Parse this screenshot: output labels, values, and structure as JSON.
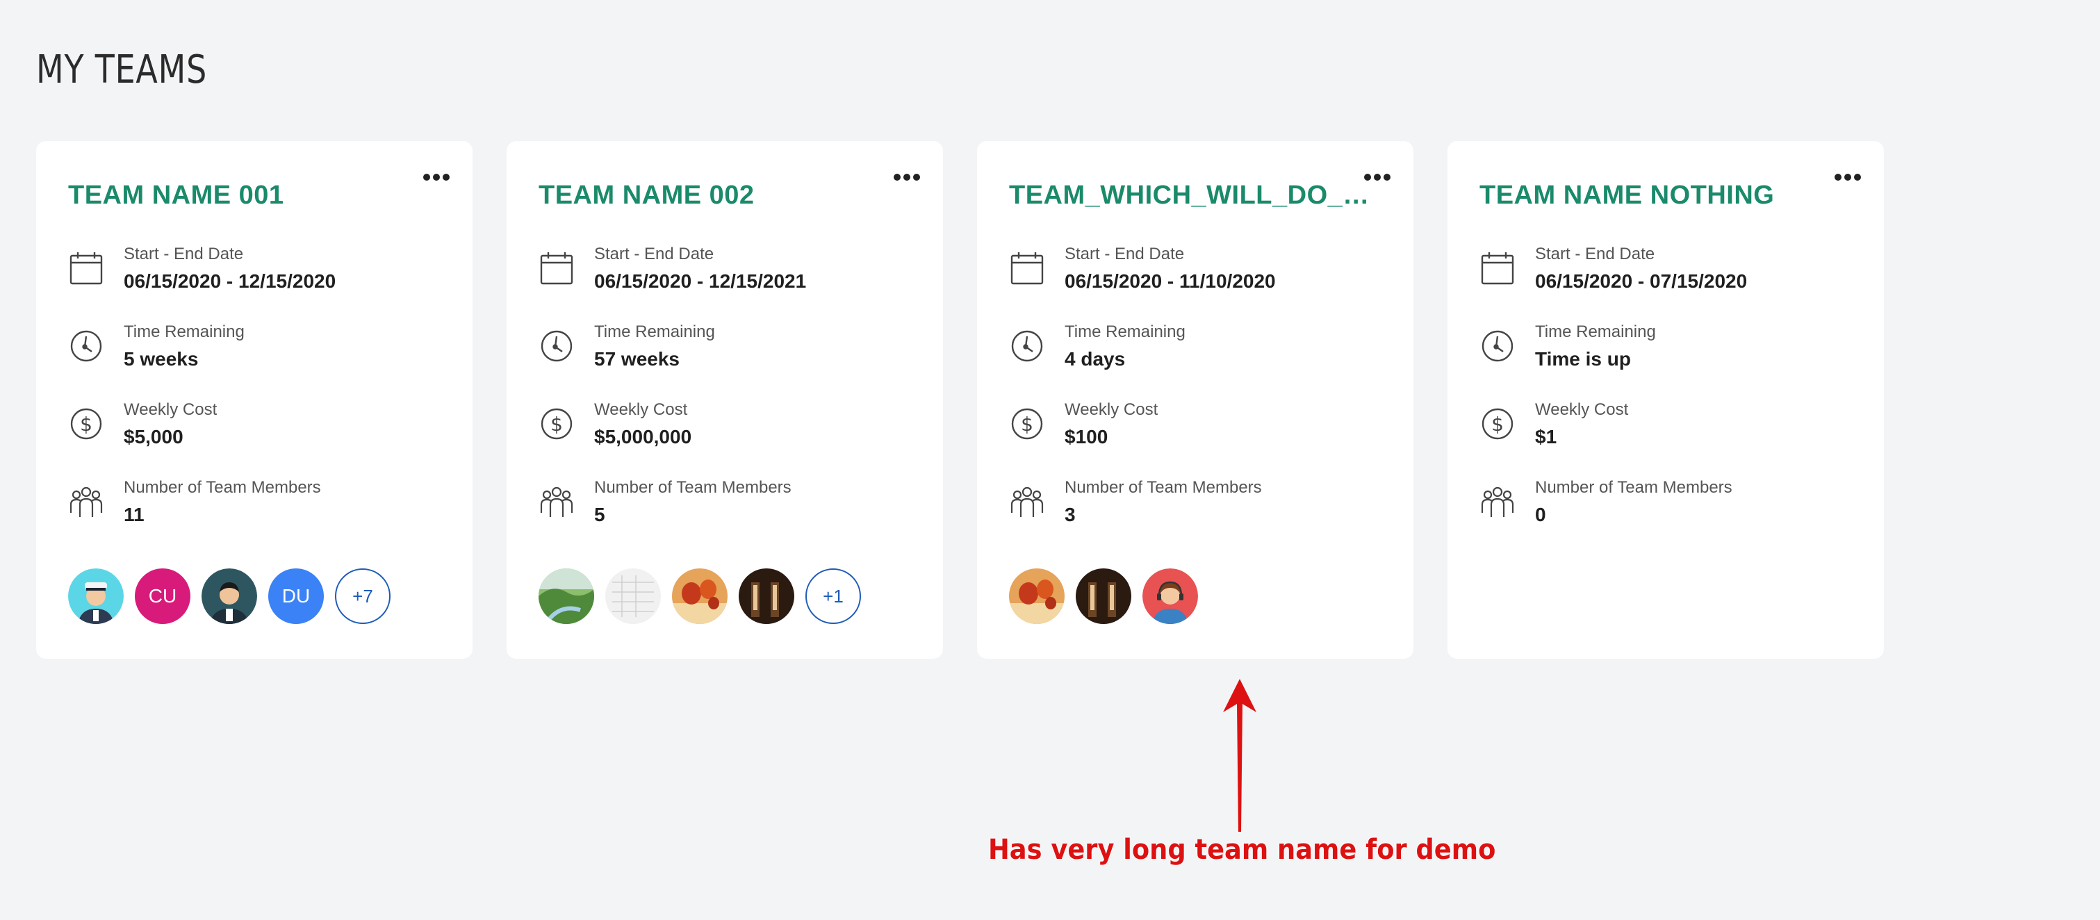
{
  "page": {
    "title": "MY TEAMS"
  },
  "labels": {
    "dates": "Start - End Date",
    "time": "Time Remaining",
    "cost": "Weekly Cost",
    "members": "Number of Team Members"
  },
  "teams": [
    {
      "name": "TEAM NAME 001",
      "dates": "06/15/2020 - 12/15/2020",
      "time_remaining": "5 weeks",
      "weekly_cost": "$5,000",
      "member_count": "11",
      "avatars": [
        {
          "type": "image",
          "icon": "captain-avatar"
        },
        {
          "type": "initials",
          "text": "CU",
          "color": "#d81b7a"
        },
        {
          "type": "image",
          "icon": "man-avatar"
        },
        {
          "type": "initials",
          "text": "DU",
          "color": "#3b82f6"
        },
        {
          "type": "more",
          "text": "+7"
        }
      ]
    },
    {
      "name": "TEAM NAME 002",
      "dates": "06/15/2020 - 12/15/2021",
      "time_remaining": "57 weeks",
      "weekly_cost": "$5,000,000",
      "member_count": "5",
      "avatars": [
        {
          "type": "image",
          "icon": "landscape-photo"
        },
        {
          "type": "image",
          "icon": "sketch-photo"
        },
        {
          "type": "image",
          "icon": "balloons-photo"
        },
        {
          "type": "image",
          "icon": "dark-room-photo"
        },
        {
          "type": "more",
          "text": "+1"
        }
      ]
    },
    {
      "name": "TEAM_WHICH_WILL_DO_EVERYTHING_EVER_NEEDED",
      "dates": "06/15/2020 - 11/10/2020",
      "time_remaining": "4 days",
      "weekly_cost": "$100",
      "member_count": "3",
      "avatars": [
        {
          "type": "image",
          "icon": "balloons-photo"
        },
        {
          "type": "image",
          "icon": "dark-room-photo"
        },
        {
          "type": "image",
          "icon": "support-agent-avatar"
        }
      ]
    },
    {
      "name": "TEAM NAME NOTHING",
      "dates": "06/15/2020 - 07/15/2020",
      "time_remaining": "Time is up",
      "weekly_cost": "$1",
      "member_count": "0",
      "avatars": []
    }
  ],
  "annotation": {
    "text": "Has very long team name for demo",
    "color": "#dd1111"
  },
  "colors": {
    "accent": "#1a8a6b",
    "background": "#f3f4f6",
    "more_border": "#1e5bb8"
  }
}
